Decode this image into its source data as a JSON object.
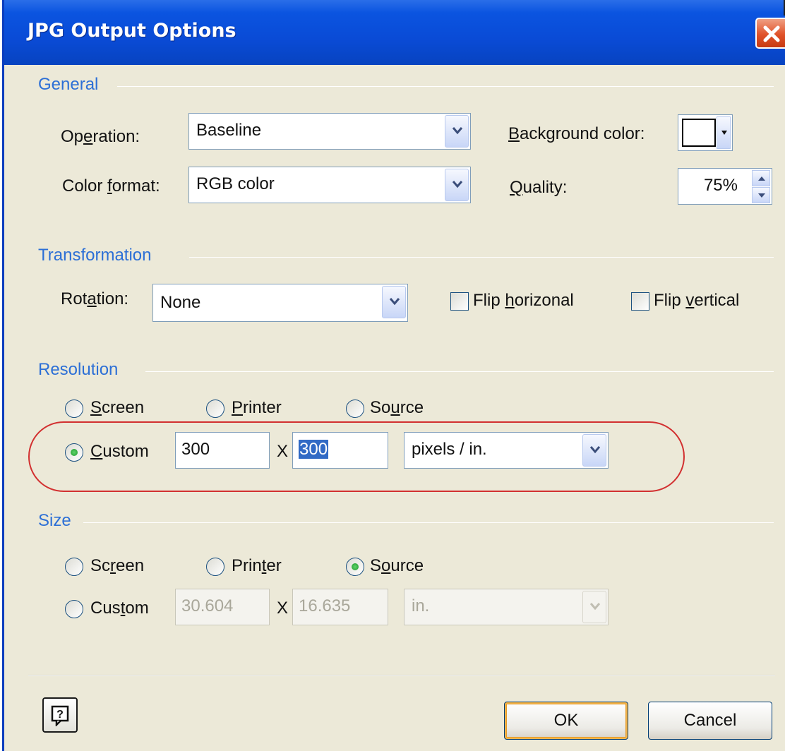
{
  "window": {
    "title": "JPG Output Options"
  },
  "general": {
    "group_label": "General",
    "operation": {
      "label_pre": "Op",
      "label_u": "e",
      "label_post": "ration:",
      "value": "Baseline"
    },
    "color_format": {
      "label_pre": "Color ",
      "label_u": "f",
      "label_post": "ormat:",
      "value": "RGB color"
    },
    "background_color": {
      "label_u": "B",
      "label_post": "ackground color:",
      "swatch": "#ffffff"
    },
    "quality": {
      "label_u": "Q",
      "label_post": "uality:",
      "value": "75%"
    }
  },
  "transformation": {
    "group_label": "Transformation",
    "rotation": {
      "label_pre": "Rot",
      "label_u": "a",
      "label_post": "tion:",
      "value": "None"
    },
    "flip_horizontal": {
      "label_pre": "Flip ",
      "label_u": "h",
      "label_post": "orizonal",
      "checked": false
    },
    "flip_vertical": {
      "label_pre": "Flip ",
      "label_u": "v",
      "label_post": "ertical",
      "checked": false
    }
  },
  "resolution": {
    "group_label": "Resolution",
    "screen": {
      "label_u": "S",
      "label_post": "creen",
      "selected": false
    },
    "printer": {
      "label_u": "P",
      "label_post": "rinter",
      "selected": false
    },
    "source": {
      "label_pre": "So",
      "label_u": "u",
      "label_post": "rce",
      "selected": false
    },
    "custom": {
      "label_u": "C",
      "label_post": "ustom",
      "selected": true
    },
    "width": "300",
    "x_label": "X",
    "height": "300",
    "units": "pixels / in."
  },
  "size": {
    "group_label": "Size",
    "screen": {
      "label_pre": "Sc",
      "label_u": "r",
      "label_post": "een",
      "selected": false
    },
    "printer": {
      "label_pre": "Prin",
      "label_u": "t",
      "label_post": "er",
      "selected": false
    },
    "source": {
      "label_pre": "S",
      "label_u": "o",
      "label_post": "urce",
      "selected": true
    },
    "custom": {
      "label_pre": "Cus",
      "label_u": "t",
      "label_post": "om",
      "selected": false
    },
    "width": "30.604",
    "x_label": "X",
    "height": "16.635",
    "units": "in."
  },
  "buttons": {
    "ok": "OK",
    "cancel": "Cancel"
  },
  "colors": {
    "title_bar": "#0a4bd6",
    "group_label": "#2c6fd6",
    "highlight_ellipse": "#d23030",
    "dialog_bg": "#ece9d8"
  }
}
